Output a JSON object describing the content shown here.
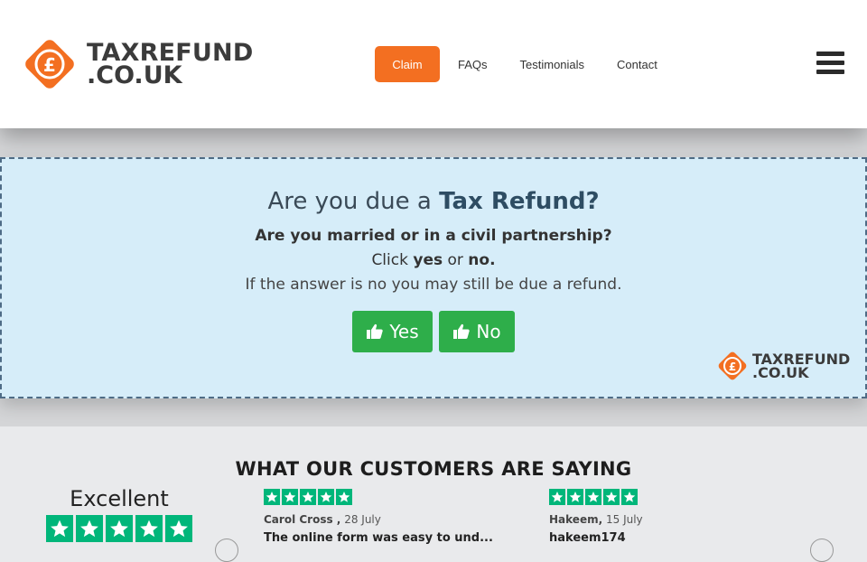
{
  "header": {
    "logo_line1": "TAXREFUND",
    "logo_line2": ".CO.UK",
    "nav": {
      "claim": "Claim",
      "faqs": "FAQs",
      "testimonials": "Testimonials",
      "contact": "Contact"
    }
  },
  "quiz": {
    "title_prefix": "Are you due a ",
    "title_bold": "Tax Refund?",
    "question": "Are you married or in a civil partnership?",
    "click_prefix": "Click ",
    "click_yes": "yes",
    "click_or": " or ",
    "click_no": "no.",
    "note": "If the answer is no you may still be due a refund.",
    "yes_label": "Yes",
    "no_label": "No",
    "logo_line1": "TAXREFUND",
    "logo_line2": ".CO.UK"
  },
  "reviews": {
    "heading": "WHAT OUR CUSTOMERS ARE SAYING",
    "rating_word": "Excellent",
    "rating_stars": 5,
    "items": [
      {
        "name": "Carol Cross",
        "sep": " ,",
        "date": "28 July",
        "text": "The online form was easy to und...",
        "stars": 5
      },
      {
        "name": "Hakeem",
        "sep": ",",
        "date": "15 July",
        "text": "hakeem174",
        "stars": 5
      }
    ]
  },
  "colors": {
    "brand_orange": "#f36f21",
    "button_green": "#2eae4a",
    "trustpilot_green": "#00b67a",
    "panel_bg": "#d6edf9"
  },
  "icons": [
    "pound-logo-icon",
    "hamburger-menu-icon",
    "thumbs-up-icon",
    "star-icon",
    "chevron-left-icon",
    "chevron-right-icon"
  ]
}
